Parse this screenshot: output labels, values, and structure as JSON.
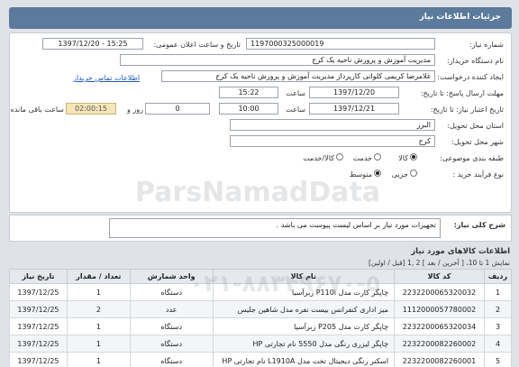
{
  "header": {
    "title": "جزئیات اطلاعات نیاز"
  },
  "form": {
    "need_number_label": "شماره نیاز:",
    "need_number": "1197000325000019",
    "announce_label": "تاریخ و ساعت اعلان عمومی:",
    "announce_value": "1397/12/20 - 15:25",
    "buyer_org_label": "نام دستگاه خریدار:",
    "buyer_org": "مدیریت آموزش و پرورش ناحیه یک کرج",
    "creator_label": "ایجاد کننده درخواست:",
    "creator": "غلامرضا کریمی کلوانی کارپرداز مدیریت آموزش و پرورش ناحیه یک کرج",
    "contact_link": "اطلاعات تماس خریدار",
    "reply_deadline_label": "مهلت ارسال پاسخ: تا تاریخ:",
    "reply_date": "1397/12/20",
    "time_label": "ساعت",
    "reply_time": "15:22",
    "validity_label": "تاریخ اعتبار نیاز: تا تاریخ:",
    "validity_date": "1397/12/21",
    "validity_time": "10:00",
    "days_value": "0",
    "days_label": "روز و",
    "remaining_time": "02:00:15",
    "remaining_label": "ساعت باقی مانده",
    "province_label": "استان محل تحویل:",
    "province": "البرز",
    "city_label": "شهر محل تحویل:",
    "city": "کرج",
    "category_label": "طبقه بندی موضوعی:",
    "category_options": [
      "کالا",
      "خدمت",
      "کالا/خدمت"
    ],
    "category_selected": 0,
    "process_label": "نوع فرآیند خرید :",
    "process_options": [
      "جزیی",
      "متوسط"
    ],
    "process_selected": 1
  },
  "description": {
    "label": "شرح کلی نیاز:",
    "text": "تجهیزات مورد نیاز بر اساس لیست پیوست می باشد ."
  },
  "items": {
    "section_title": "اطلاعات کالاهای مورد نیاز",
    "pager_text": "نمایش 1 تا 10، [ آخرین / بعد ] 2 ,1 [قبل / اولین]",
    "columns": [
      "ردیف",
      "کد کالا",
      "نام کالا",
      "واحد شمارش",
      "تعداد / مقدار",
      "تاریخ نیاز"
    ],
    "rows": [
      {
        "idx": "1",
        "code": "2232200065320032",
        "name": "چاپگر کارت مدل P110i زبرآسیا",
        "unit": "دستگاه",
        "qty": "1",
        "date": "1397/12/25"
      },
      {
        "idx": "2",
        "code": "1112000057780002",
        "name": "میز اداری کنفرانس بیست نفره مدل شاهین جلیس",
        "unit": "عدد",
        "qty": "2",
        "date": "1397/12/25"
      },
      {
        "idx": "3",
        "code": "2232200065320034",
        "name": "چاپگر کارت مدل P205 زبرآسیا",
        "unit": "دستگاه",
        "qty": "1",
        "date": "1397/12/25"
      },
      {
        "idx": "4",
        "code": "2232200082260002",
        "name": "چاپگر لیزری رنگی مدل 5550 نام تجارتی HP",
        "unit": "دستگاه",
        "qty": "1",
        "date": "1397/12/25"
      },
      {
        "idx": "5",
        "code": "2232200082260001",
        "name": "اسکنر رنگی دیجیتال تخت مدل L1910A نام تجارتی HP",
        "unit": "دستگاه",
        "qty": "1",
        "date": "1397/12/25"
      }
    ]
  },
  "watermark": {
    "brand": "ParsNamadData",
    "phone": "۰۲۱-۸۸۳۴۹۶۷۰-۵"
  }
}
